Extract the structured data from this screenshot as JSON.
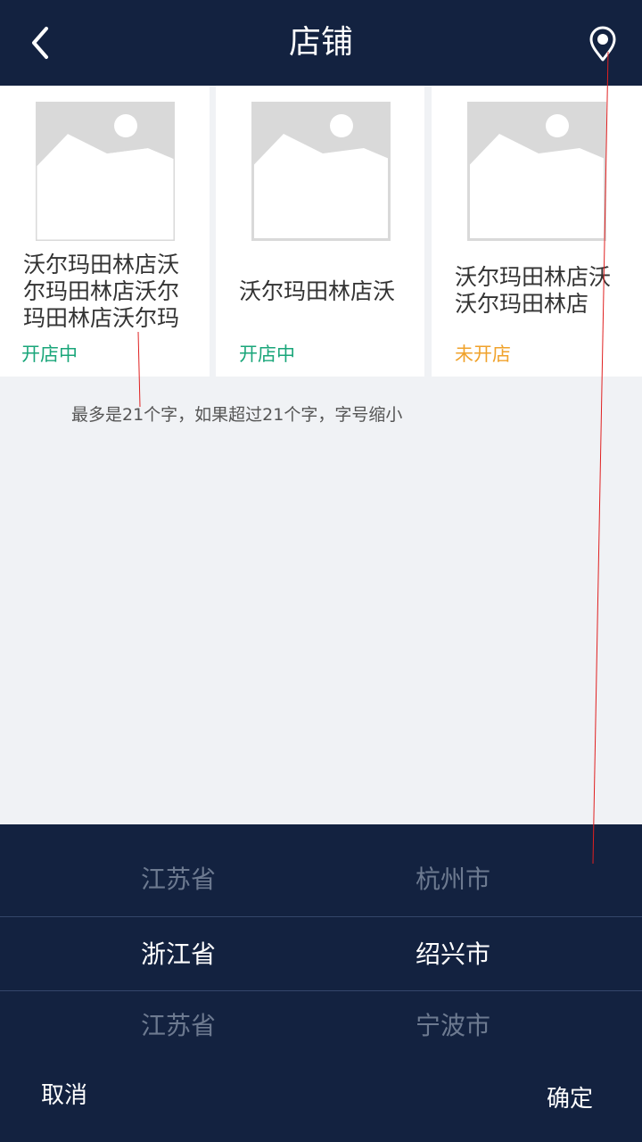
{
  "header": {
    "title": "店铺",
    "back_icon": "chevron-left-icon",
    "location_icon": "map-pin-icon"
  },
  "shops": [
    {
      "name": "沃尔玛田林店沃尔玛田林店沃尔玛田林店沃尔玛",
      "status": "开店中",
      "status_color": "#1aa67a"
    },
    {
      "name": "沃尔玛田林店沃",
      "status": "开店中",
      "status_color": "#1aa67a"
    },
    {
      "name": "沃尔玛田林店沃沃尔玛田林店",
      "status": "未开店",
      "status_color": "#f0a22b"
    }
  ],
  "annotation": "最多是21个字，如果超过21个字，字号缩小",
  "picker": {
    "rows": [
      {
        "province": "江苏省",
        "city": "杭州市",
        "selected": false
      },
      {
        "province": "浙江省",
        "city": "绍兴市",
        "selected": true
      },
      {
        "province": "江苏省",
        "city": "宁波市",
        "selected": false
      }
    ],
    "cancel_label": "取消",
    "confirm_label": "确定"
  },
  "colors": {
    "header_bg": "#132240",
    "page_bg": "#f0f2f5",
    "open_status": "#1aa67a",
    "closed_status": "#f0a22b",
    "annotation_line": "#e02020"
  }
}
